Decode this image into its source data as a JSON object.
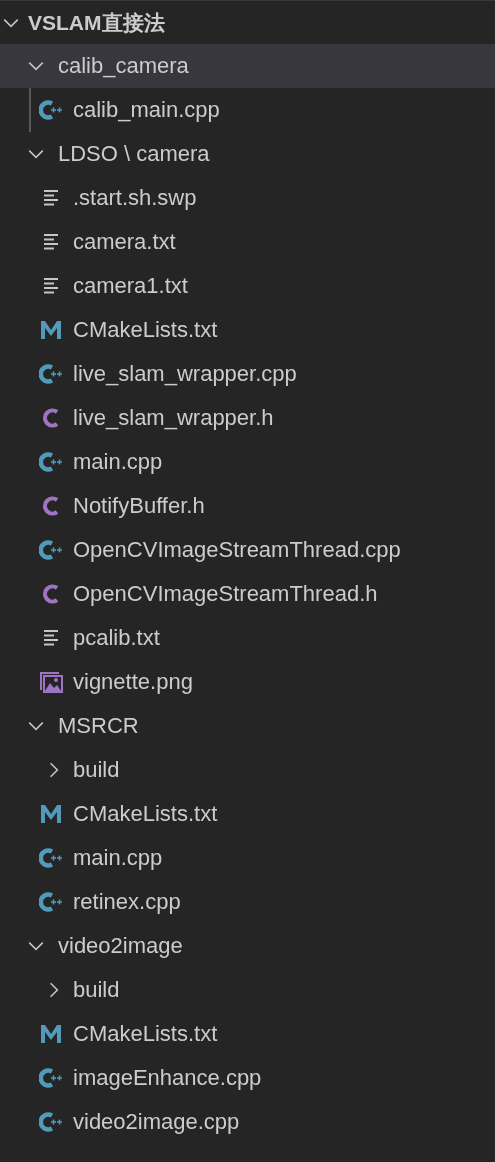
{
  "root": {
    "label": "VSLAM直接法",
    "expanded": true
  },
  "tree": [
    {
      "kind": "folder",
      "label": "calib_camera",
      "expanded": true,
      "selected": true,
      "children": [
        {
          "kind": "cpp",
          "label": "calib_main.cpp",
          "selected": false
        }
      ]
    },
    {
      "kind": "folder",
      "label": "LDSO \\ camera",
      "expanded": true,
      "selected": false,
      "children": [
        {
          "kind": "text",
          "label": ".start.sh.swp",
          "selected": false
        },
        {
          "kind": "text",
          "label": "camera.txt",
          "selected": false
        },
        {
          "kind": "text",
          "label": "camera1.txt",
          "selected": false
        },
        {
          "kind": "cmake",
          "label": "CMakeLists.txt",
          "selected": false
        },
        {
          "kind": "cpp",
          "label": "live_slam_wrapper.cpp",
          "selected": false
        },
        {
          "kind": "header",
          "label": "live_slam_wrapper.h",
          "selected": false
        },
        {
          "kind": "cpp",
          "label": "main.cpp",
          "selected": false
        },
        {
          "kind": "header",
          "label": "NotifyBuffer.h",
          "selected": false
        },
        {
          "kind": "cpp",
          "label": "OpenCVImageStreamThread.cpp",
          "selected": false
        },
        {
          "kind": "header",
          "label": "OpenCVImageStreamThread.h",
          "selected": false
        },
        {
          "kind": "text",
          "label": "pcalib.txt",
          "selected": false
        },
        {
          "kind": "image",
          "label": "vignette.png",
          "selected": false
        }
      ]
    },
    {
      "kind": "folder",
      "label": "MSRCR",
      "expanded": true,
      "selected": false,
      "children": [
        {
          "kind": "folder",
          "label": "build",
          "expanded": false,
          "selected": false
        },
        {
          "kind": "cmake",
          "label": "CMakeLists.txt",
          "selected": false
        },
        {
          "kind": "cpp",
          "label": "main.cpp",
          "selected": false
        },
        {
          "kind": "cpp",
          "label": "retinex.cpp",
          "selected": false
        }
      ]
    },
    {
      "kind": "folder",
      "label": "video2image",
      "expanded": true,
      "selected": false,
      "children": [
        {
          "kind": "folder",
          "label": "build",
          "expanded": false,
          "selected": false
        },
        {
          "kind": "cmake",
          "label": "CMakeLists.txt",
          "selected": false
        },
        {
          "kind": "cpp",
          "label": "imageEnhance.cpp",
          "selected": false
        },
        {
          "kind": "cpp",
          "label": "video2image.cpp",
          "selected": false
        }
      ]
    }
  ]
}
